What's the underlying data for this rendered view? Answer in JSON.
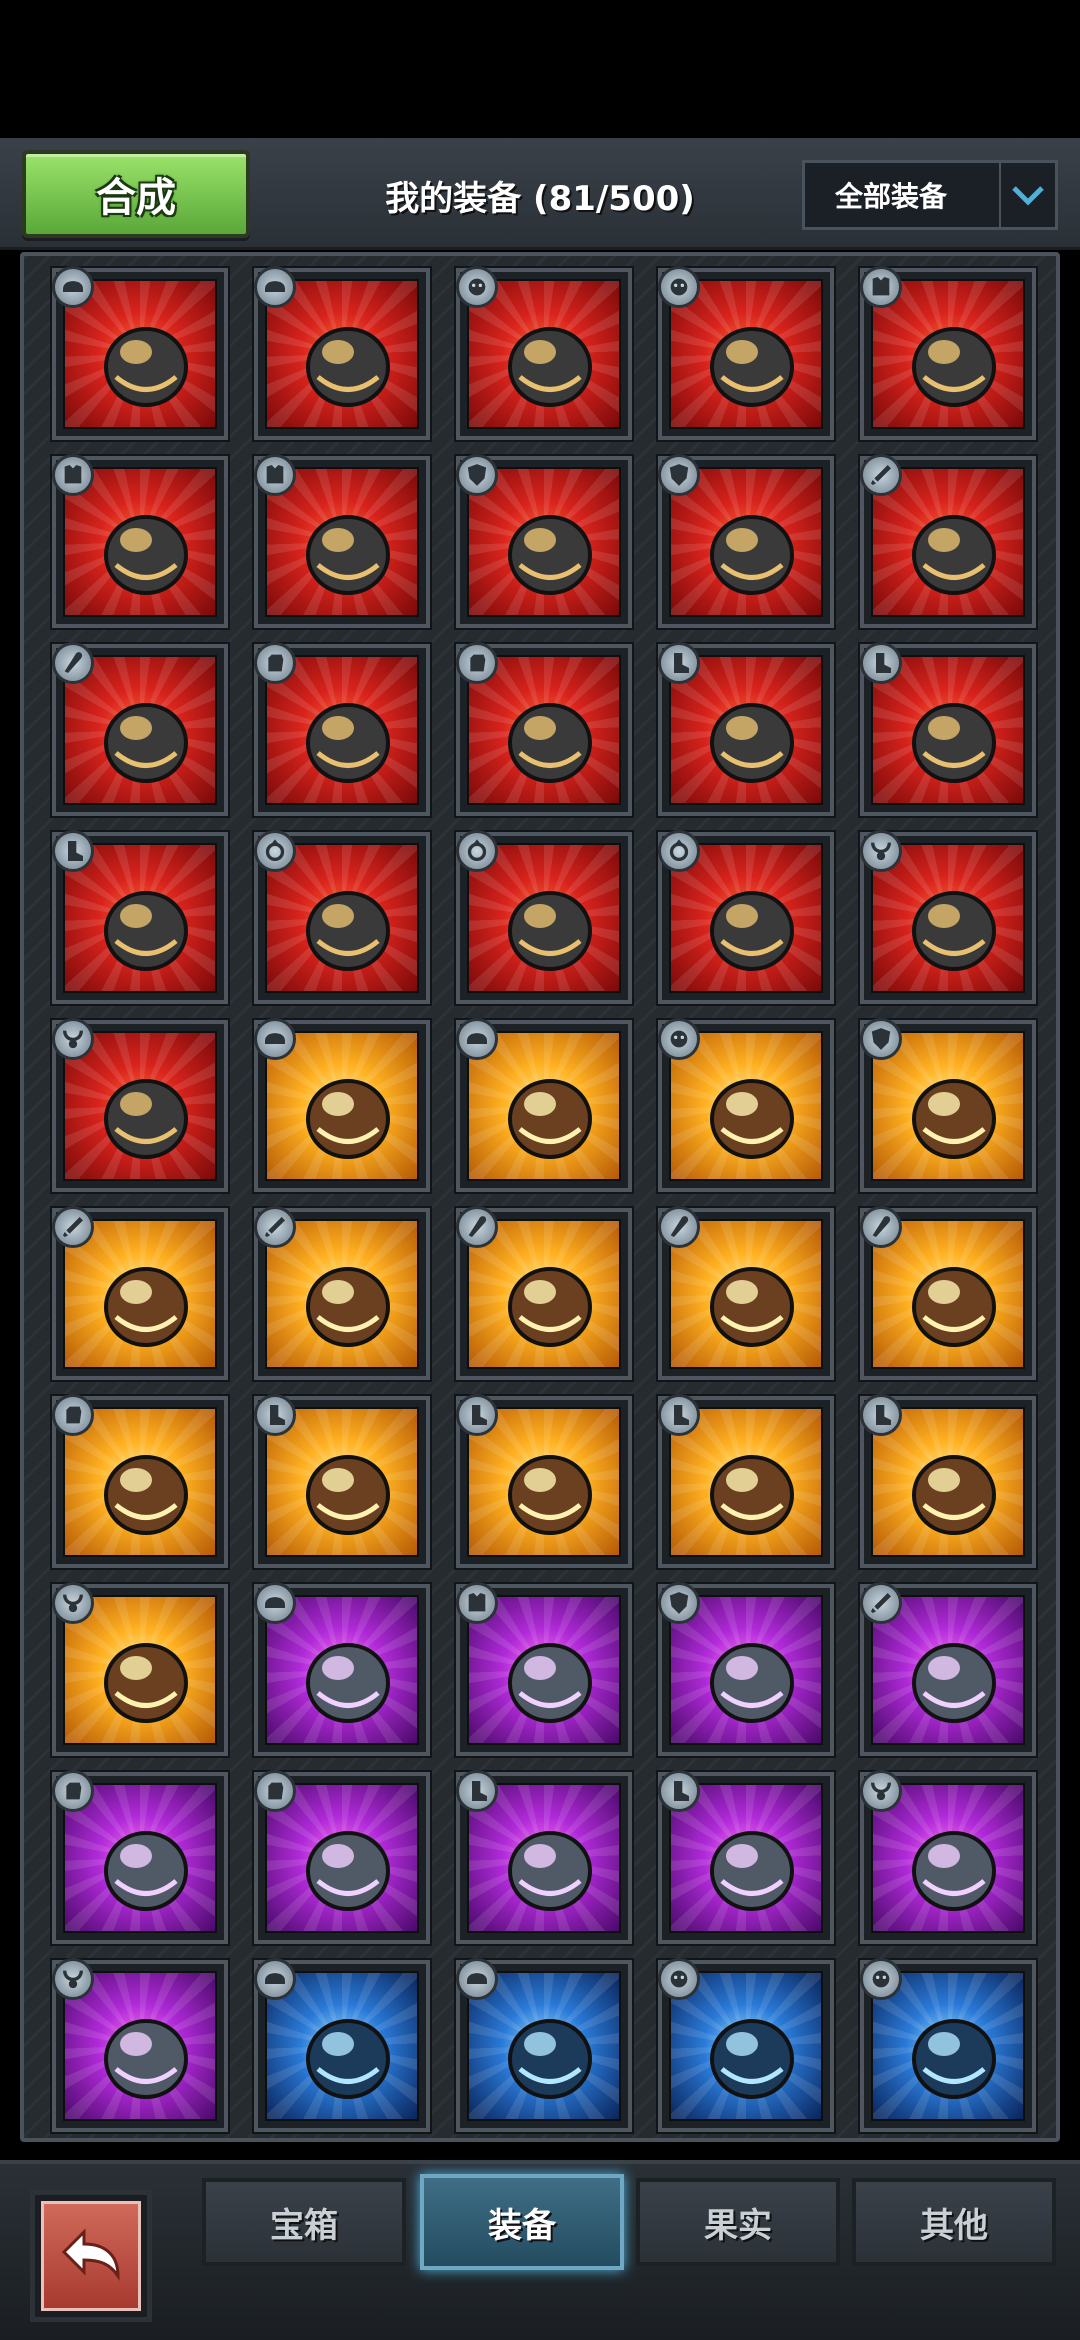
{
  "header": {
    "merge_label": "合成",
    "title": "我的装备 (81/500)",
    "filter_label": "全部装备"
  },
  "tabs": [
    {
      "label": "宝箱",
      "active": false
    },
    {
      "label": "装备",
      "active": true
    },
    {
      "label": "果实",
      "active": false
    },
    {
      "label": "其他",
      "active": false
    }
  ],
  "colors": {
    "accent_green": "#7ccf4f",
    "rarity_red": "#d8231c",
    "rarity_gold": "#ffb020",
    "rarity_purple": "#b02ad8",
    "rarity_blue": "#2a7ad8"
  },
  "inventory": [
    [
      {
        "item": "monster-helmet",
        "rarity": "red",
        "slot": "helmet"
      },
      {
        "item": "monster-helmet",
        "rarity": "red",
        "slot": "helmet"
      },
      {
        "item": "mystery-orb",
        "rarity": "red",
        "slot": "accessory"
      },
      {
        "item": "mystery-orb",
        "rarity": "red",
        "slot": "accessory"
      },
      {
        "item": "hero-armor",
        "rarity": "red",
        "slot": "armor"
      }
    ],
    [
      {
        "item": "hero-armor",
        "rarity": "red",
        "slot": "armor"
      },
      {
        "item": "hero-armor",
        "rarity": "red",
        "slot": "armor"
      },
      {
        "item": "golden-wing-shield",
        "rarity": "red",
        "slot": "shield"
      },
      {
        "item": "golden-wing-shield",
        "rarity": "red",
        "slot": "shield"
      },
      {
        "item": "red-spear",
        "rarity": "red",
        "slot": "weapon"
      }
    ],
    [
      {
        "item": "winged-scepter",
        "rarity": "red",
        "slot": "staff"
      },
      {
        "item": "infinity-gauntlet",
        "rarity": "red",
        "slot": "gloves"
      },
      {
        "item": "infinity-gauntlet",
        "rarity": "red",
        "slot": "gloves"
      },
      {
        "item": "net-stockings",
        "rarity": "red",
        "slot": "boots"
      },
      {
        "item": "net-stockings",
        "rarity": "red",
        "slot": "boots"
      }
    ],
    [
      {
        "item": "net-stockings",
        "rarity": "red",
        "slot": "boots"
      },
      {
        "item": "claw-ring",
        "rarity": "red",
        "slot": "ring"
      },
      {
        "item": "claw-ring",
        "rarity": "red",
        "slot": "ring"
      },
      {
        "item": "claw-ring",
        "rarity": "red",
        "slot": "ring"
      },
      {
        "item": "moon-necklace",
        "rarity": "red",
        "slot": "necklace"
      }
    ],
    [
      {
        "item": "moon-necklace",
        "rarity": "red",
        "slot": "necklace"
      },
      {
        "item": "stone-crown",
        "rarity": "gold",
        "slot": "helmet"
      },
      {
        "item": "stone-crown",
        "rarity": "gold",
        "slot": "helmet"
      },
      {
        "item": "fire-mask",
        "rarity": "gold",
        "slot": "accessory"
      },
      {
        "item": "crystal-shield",
        "rarity": "gold",
        "slot": "shield"
      }
    ],
    [
      {
        "item": "blue-hilt-sword",
        "rarity": "gold",
        "slot": "weapon"
      },
      {
        "item": "blue-hilt-sword",
        "rarity": "gold",
        "slot": "weapon"
      },
      {
        "item": "sun-staff",
        "rarity": "gold",
        "slot": "staff"
      },
      {
        "item": "sun-staff",
        "rarity": "gold",
        "slot": "staff"
      },
      {
        "item": "sun-staff",
        "rarity": "gold",
        "slot": "staff"
      }
    ],
    [
      {
        "item": "bone-claw-glove",
        "rarity": "gold",
        "slot": "gloves"
      },
      {
        "item": "crimson-boots",
        "rarity": "gold",
        "slot": "boots"
      },
      {
        "item": "crimson-boots",
        "rarity": "gold",
        "slot": "boots"
      },
      {
        "item": "crimson-boots",
        "rarity": "gold",
        "slot": "boots"
      },
      {
        "item": "crimson-boots",
        "rarity": "gold",
        "slot": "boots"
      }
    ],
    [
      {
        "item": "jade-necklace",
        "rarity": "gold",
        "slot": "necklace"
      },
      {
        "item": "knight-helm",
        "rarity": "purple",
        "slot": "helmet"
      },
      {
        "item": "silver-armor",
        "rarity": "purple",
        "slot": "armor"
      },
      {
        "item": "crimson-shield",
        "rarity": "purple",
        "slot": "shield"
      },
      {
        "item": "curved-dagger",
        "rarity": "purple",
        "slot": "weapon"
      }
    ],
    [
      {
        "item": "bronze-gauntlet",
        "rarity": "purple",
        "slot": "gloves"
      },
      {
        "item": "bronze-gauntlet",
        "rarity": "purple",
        "slot": "gloves"
      },
      {
        "item": "roller-skates",
        "rarity": "purple",
        "slot": "boots"
      },
      {
        "item": "roller-skates",
        "rarity": "purple",
        "slot": "boots"
      },
      {
        "item": "fang-necklace",
        "rarity": "purple",
        "slot": "necklace"
      }
    ],
    [
      {
        "item": "fang-necklace",
        "rarity": "purple",
        "slot": "necklace"
      },
      {
        "item": "cloth-hood",
        "rarity": "blue",
        "slot": "helmet"
      },
      {
        "item": "cloth-hood",
        "rarity": "blue",
        "slot": "helmet"
      },
      {
        "item": "rune-shield",
        "rarity": "blue",
        "slot": "accessory"
      },
      {
        "item": "rune-shield",
        "rarity": "blue",
        "slot": "accessory"
      }
    ]
  ]
}
